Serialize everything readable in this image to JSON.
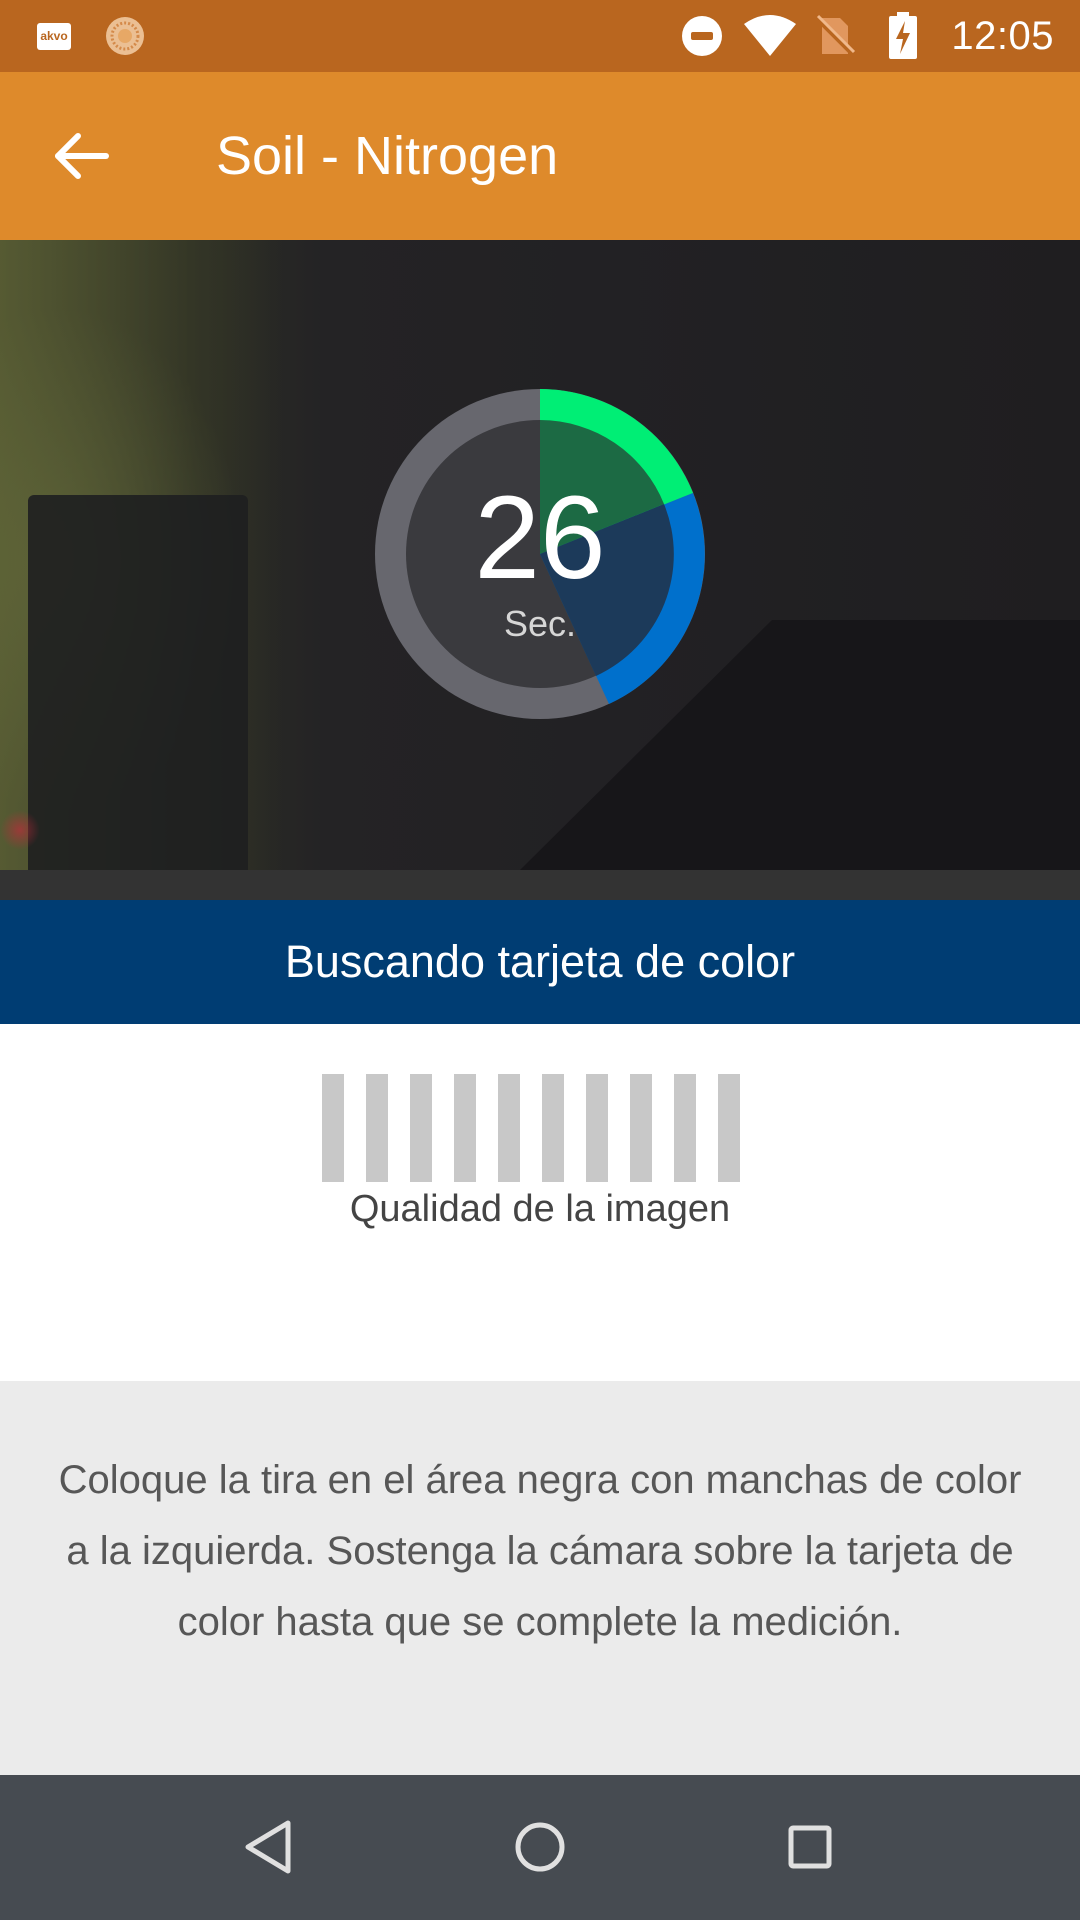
{
  "status_bar": {
    "time": "12:05",
    "akvo_badge": "akvo",
    "icons": [
      "akvo-notification-icon",
      "sun-notification-icon",
      "do-not-disturb-icon",
      "wifi-icon",
      "no-sim-icon",
      "battery-charging-icon"
    ]
  },
  "app_bar": {
    "title": "Soil - Nitrogen",
    "back_icon": "arrow-left-icon"
  },
  "camera": {
    "timer_value": "26",
    "timer_unit": "Sec.",
    "timer_colors": {
      "green": "#00ee75",
      "blue": "#0070cc",
      "ring": "#6a6a70"
    }
  },
  "status_strip": {
    "text": "Buscando tarjeta de color",
    "color": "#003d73"
  },
  "quality": {
    "label": "Qualidad de la imagen",
    "bar_count": 10,
    "filled_bars": 0
  },
  "instructions": {
    "text": "Coloque la tira en el área negra con manchas de color a la izquierda. Sostenga la cámara sobre la tarjeta de color hasta que se complete la medición."
  },
  "nav_bar": {
    "icons": [
      "back-triangle-icon",
      "home-circle-icon",
      "recents-square-icon"
    ]
  },
  "colors": {
    "status_bar": "#b9661f",
    "app_bar": "#de8a2b",
    "nav_bar": "#464b51"
  }
}
